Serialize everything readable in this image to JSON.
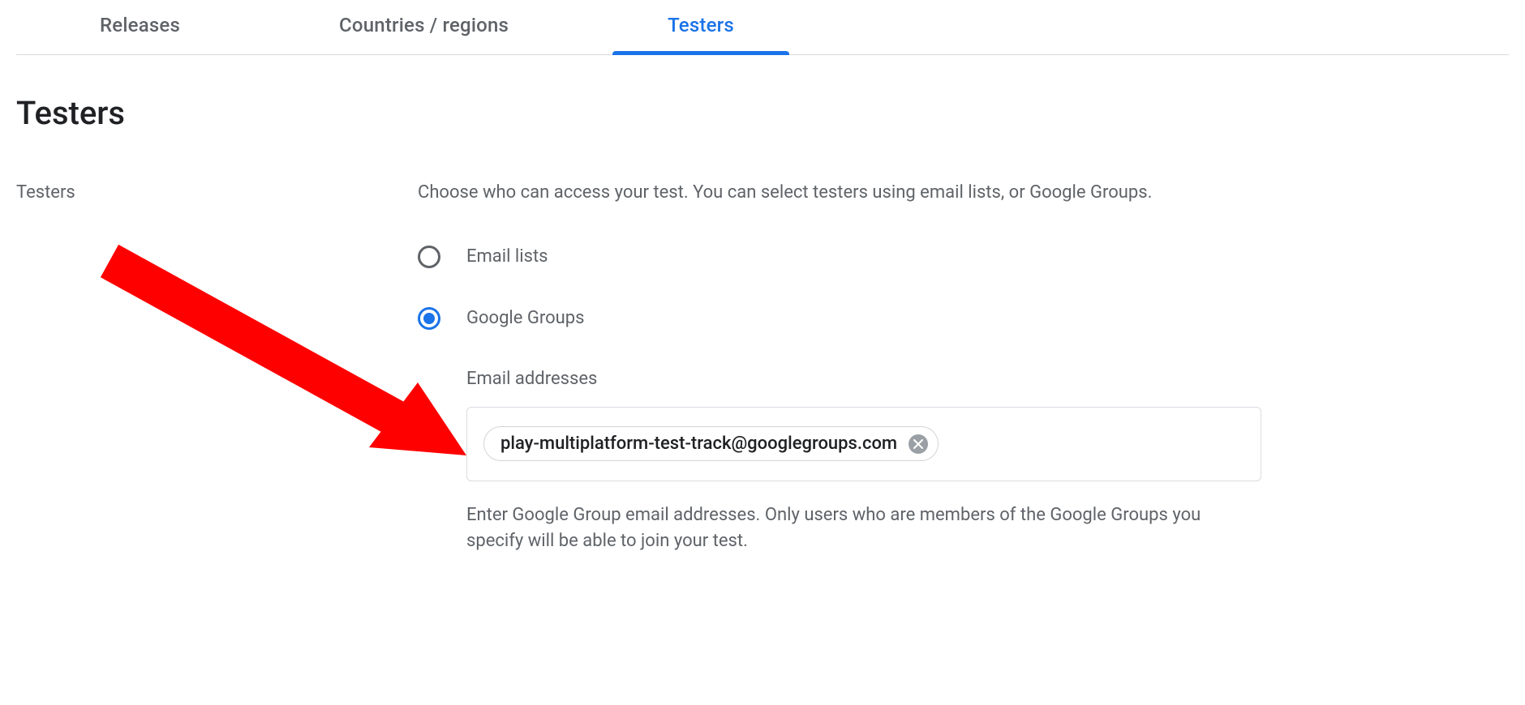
{
  "tabs": [
    {
      "label": "Releases",
      "active": false
    },
    {
      "label": "Countries / regions",
      "active": false
    },
    {
      "label": "Testers",
      "active": true
    }
  ],
  "page_title": "Testers",
  "section": {
    "label": "Testers",
    "description": "Choose who can access your test. You can select testers using email lists, or Google Groups.",
    "options": [
      {
        "label": "Email lists",
        "checked": false
      },
      {
        "label": "Google Groups",
        "checked": true
      }
    ],
    "field_sublabel": "Email addresses",
    "chips": [
      "play-multiplatform-test-track@googlegroups.com"
    ],
    "helper": "Enter Google Group email addresses. Only users who are members of the Google Groups you specify will be able to join your test."
  }
}
